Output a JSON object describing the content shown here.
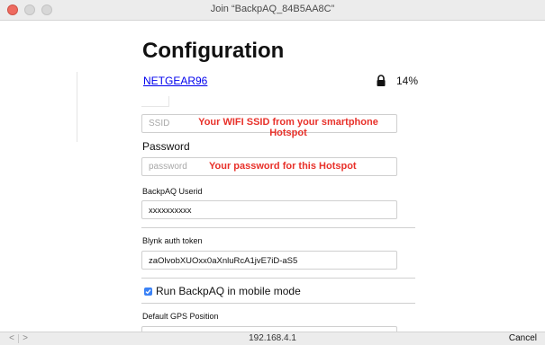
{
  "window": {
    "title": "Join “BackpAQ_84B5AA8C”"
  },
  "page": {
    "title": "Configuration"
  },
  "network": {
    "ssid_link": "NETGEAR96",
    "lock_icon": "lock-icon",
    "signal": "14%"
  },
  "form": {
    "ssid": {
      "placeholder": "SSID",
      "value": ""
    },
    "ssid_annotation": "Your WIFI SSID from your smartphone Hotspot",
    "password_label": "Password",
    "password": {
      "placeholder": "password",
      "value": ""
    },
    "password_annotation": "Your password for this Hotspot",
    "userid_label": "BackpAQ Userid",
    "userid_value": "xxxxxxxxxx",
    "blynk_label": "Blynk auth token",
    "blynk_value": "zaOlvobXUOxx0aXnluRcA1jvE7iD-aS5",
    "mobile_mode_label": "Run BackpAQ in mobile mode",
    "mobile_mode_checked": true,
    "gps_label": "Default GPS Position"
  },
  "statusbar": {
    "back": "<",
    "forward": ">",
    "address": "192.168.4.1",
    "cancel": "Cancel"
  },
  "colors": {
    "annotation": "#e8312a",
    "link": "#0000ee",
    "checkbox": "#3b82f6"
  }
}
